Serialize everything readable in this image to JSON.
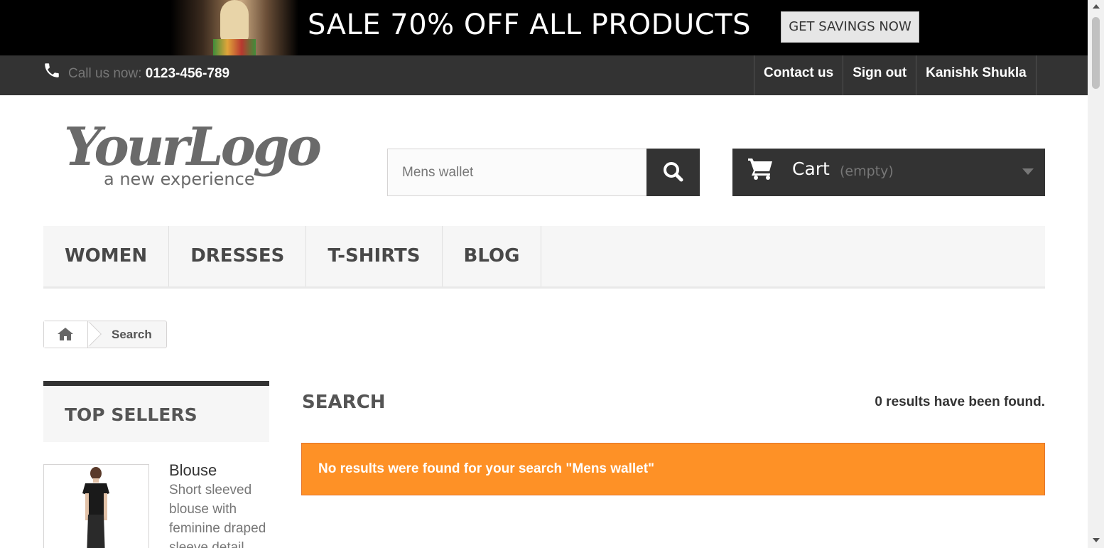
{
  "banner": {
    "headline": "SALE 70% OFF ALL PRODUCTS",
    "cta_label": "GET SAVINGS NOW"
  },
  "topbar": {
    "call_label": "Call us now:",
    "phone": "0123-456-789",
    "links": [
      "Contact us",
      "Sign out",
      "Kanishk Shukla"
    ],
    "phone_icon": "phone-icon"
  },
  "header": {
    "logo_text": "YourLogo",
    "logo_tagline": "a new experience",
    "search": {
      "value": "Mens wallet",
      "icon": "search-icon"
    },
    "cart": {
      "label": "Cart",
      "status": "(empty)",
      "icon": "cart-icon"
    }
  },
  "menu": {
    "items": [
      "WOMEN",
      "DRESSES",
      "T-SHIRTS",
      "BLOG"
    ]
  },
  "breadcrumb": {
    "home_icon": "home-icon",
    "current": "Search"
  },
  "sidebar": {
    "title": "TOP SELLERS",
    "products": [
      {
        "name": "Blouse",
        "description": "Short sleeved blouse with feminine draped sleeve detail."
      }
    ]
  },
  "main": {
    "title": "SEARCH",
    "results_count": "0 results have been found.",
    "alert": "No results were found for your search \"Mens wallet\""
  },
  "colors": {
    "dark": "#333333",
    "alert": "#fe9126",
    "menu_bg": "#f6f6f6"
  }
}
